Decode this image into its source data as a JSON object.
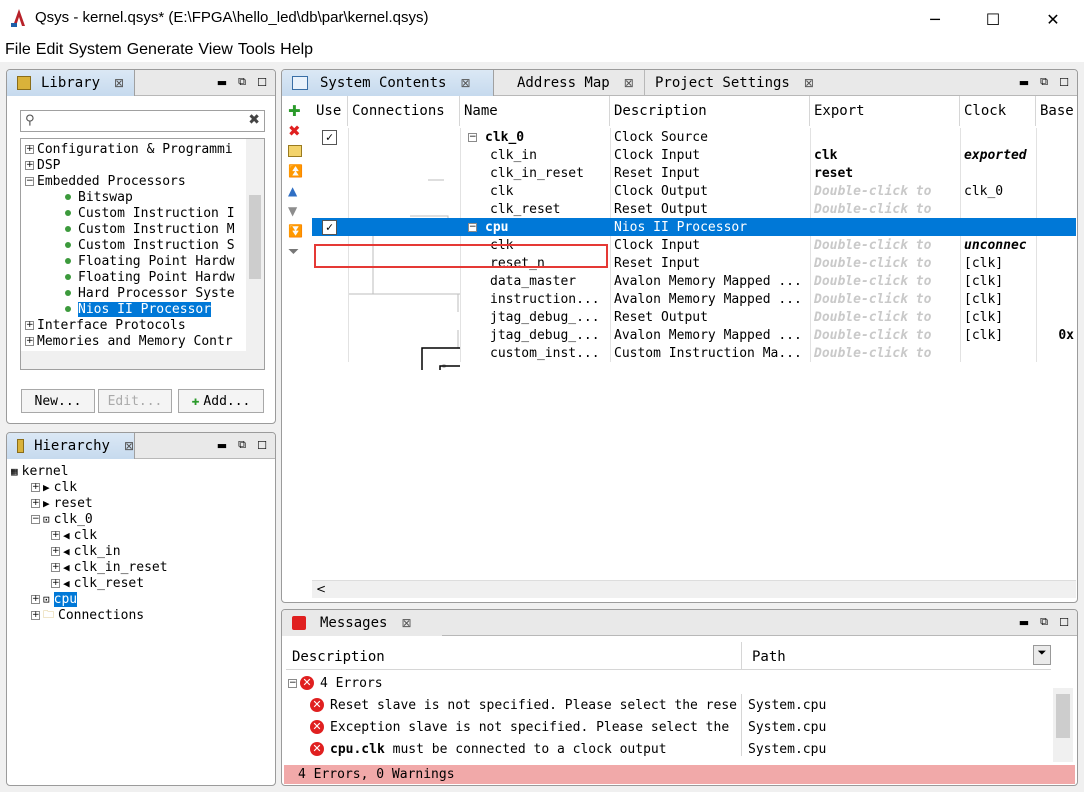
{
  "window": {
    "title": "Qsys - kernel.qsys* (E:\\FPGA\\hello_led\\db\\par\\kernel.qsys)",
    "minimize": "─",
    "maximize": "☐",
    "close": "✕"
  },
  "menu": [
    "File",
    "Edit",
    "System",
    "Generate",
    "View",
    "Tools",
    "Help"
  ],
  "library": {
    "tab_label": "Library",
    "search_placeholder": "",
    "items": [
      {
        "label": "Configuration & Programmi",
        "level": 0,
        "expander": "+"
      },
      {
        "label": "DSP",
        "level": 0,
        "expander": "+"
      },
      {
        "label": "Embedded Processors",
        "level": 0,
        "expander": "−"
      },
      {
        "label": "Bitswap",
        "level": 1
      },
      {
        "label": "Custom Instruction I",
        "level": 1
      },
      {
        "label": "Custom Instruction M",
        "level": 1
      },
      {
        "label": "Custom Instruction S",
        "level": 1
      },
      {
        "label": "Floating Point Hardw",
        "level": 1
      },
      {
        "label": "Floating Point Hardw",
        "level": 1
      },
      {
        "label": "Hard Processor Syste",
        "level": 1
      },
      {
        "label": "Nios II Processor",
        "level": 1,
        "selected": true
      },
      {
        "label": "Interface Protocols",
        "level": 0,
        "expander": "+"
      },
      {
        "label": "Memories and Memory Contr",
        "level": 0,
        "expander": "+"
      }
    ],
    "buttons": {
      "new": "New...",
      "edit": "Edit...",
      "add": "Add..."
    }
  },
  "hierarchy": {
    "tab_label": "Hierarchy",
    "items": [
      {
        "label": "kernel",
        "level": 0,
        "icon": "system-icon"
      },
      {
        "label": "clk",
        "level": 1,
        "expander": "+",
        "icon": "export-icon"
      },
      {
        "label": "reset",
        "level": 1,
        "expander": "+",
        "icon": "export-icon"
      },
      {
        "label": "clk_0",
        "level": 1,
        "expander": "−",
        "icon": "module-icon"
      },
      {
        "label": "clk",
        "level": 2,
        "expander": "+",
        "icon": "port-icon"
      },
      {
        "label": "clk_in",
        "level": 2,
        "expander": "+",
        "icon": "port-icon"
      },
      {
        "label": "clk_in_reset",
        "level": 2,
        "expander": "+",
        "icon": "port-icon"
      },
      {
        "label": "clk_reset",
        "level": 2,
        "expander": "+",
        "icon": "port-icon"
      },
      {
        "label": "cpu",
        "level": 1,
        "expander": "+",
        "icon": "module-icon",
        "selected": true
      },
      {
        "label": "Connections",
        "level": 1,
        "expander": "+",
        "icon": "folder-icon"
      }
    ]
  },
  "system_contents": {
    "tabs": [
      "System Contents",
      "Address Map",
      "Project Settings"
    ],
    "columns": [
      "Use",
      "Connections",
      "Name",
      "Description",
      "Export",
      "Clock",
      "Base"
    ],
    "double_click": "Double-click to",
    "rows": [
      {
        "use": "✓",
        "collapse": "−",
        "name": "clk_0",
        "bold": true,
        "description": "Clock Source",
        "export": "",
        "clock": "",
        "base": ""
      },
      {
        "name": "clk_in",
        "description": "Clock Input",
        "export": "clk",
        "export_bold": true,
        "clock": "exported",
        "clock_style": "bolditalic",
        "base": ""
      },
      {
        "name": "clk_in_reset",
        "description": "Reset Input",
        "export": "reset",
        "export_bold": true,
        "clock": "",
        "base": ""
      },
      {
        "name": "clk",
        "description": "Clock Output",
        "export": "dbl",
        "clock": "clk_0",
        "base": ""
      },
      {
        "name": "clk_reset",
        "description": "Reset Output",
        "export": "dbl",
        "clock": "",
        "base": ""
      },
      {
        "use": "✓",
        "collapse": "−",
        "name": "cpu",
        "bold": true,
        "description": "Nios II Processor",
        "export": "",
        "clock": "",
        "base": "",
        "selected": true
      },
      {
        "name": "clk",
        "description": "Clock Input",
        "export": "dbl",
        "clock": "unconnec",
        "clock_style": "bolditalic",
        "base": ""
      },
      {
        "name": "reset_n",
        "description": "Reset Input",
        "export": "dbl",
        "clock": "[clk]",
        "base": ""
      },
      {
        "name": "data_master",
        "description": "Avalon Memory Mapped ...",
        "export": "dbl",
        "clock": "[clk]",
        "base": ""
      },
      {
        "name": "instruction...",
        "description": "Avalon Memory Mapped ...",
        "export": "dbl",
        "clock": "[clk]",
        "base": ""
      },
      {
        "name": "jtag_debug_...",
        "description": "Reset Output",
        "export": "dbl",
        "clock": "[clk]",
        "base": ""
      },
      {
        "name": "jtag_debug_...",
        "description": "Avalon Memory Mapped ...",
        "export": "dbl",
        "clock": "[clk]",
        "base": "0x"
      },
      {
        "name": "custom_inst...",
        "description": "Custom Instruction Ma...",
        "export": "dbl",
        "clock": "",
        "base": ""
      }
    ]
  },
  "messages": {
    "tab_label": "Messages",
    "columns": [
      "Description",
      "Path"
    ],
    "group": "4 Errors",
    "items": [
      {
        "pre": "",
        "bold": "",
        "text": "Reset slave is not specified. Please select the rese",
        "path": "System.cpu"
      },
      {
        "pre": "",
        "bold": "",
        "text": "Exception slave is not specified. Please select the",
        "path": "System.cpu"
      },
      {
        "pre": "",
        "bold": "cpu.clk",
        "text": " must be connected to a clock output",
        "path": "System.cpu"
      }
    ],
    "status": "4 Errors, 0 Warnings"
  }
}
